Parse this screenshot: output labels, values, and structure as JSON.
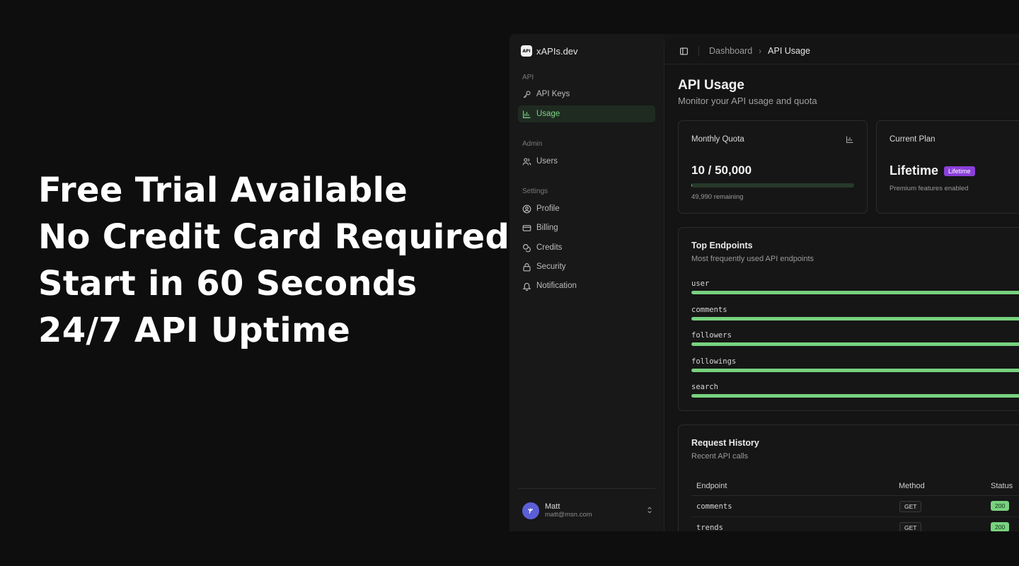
{
  "hero": {
    "lines": [
      "Free Trial Available",
      "No Credit Card Required",
      "Start in 60 Seconds",
      "24/7 API Uptime"
    ]
  },
  "app": {
    "brand": {
      "logo_text": "API",
      "name": "xAPIs.dev"
    },
    "sidebar": {
      "sections": [
        {
          "label": "API",
          "items": [
            {
              "label": "API Keys",
              "icon": "key-icon",
              "active": false
            },
            {
              "label": "Usage",
              "icon": "bar-chart-icon",
              "active": true
            }
          ]
        },
        {
          "label": "Admin",
          "items": [
            {
              "label": "Users",
              "icon": "users-icon",
              "active": false
            }
          ]
        },
        {
          "label": "Settings",
          "items": [
            {
              "label": "Profile",
              "icon": "profile-icon",
              "active": false
            },
            {
              "label": "Billing",
              "icon": "credit-card-icon",
              "active": false
            },
            {
              "label": "Credits",
              "icon": "coins-icon",
              "active": false
            },
            {
              "label": "Security",
              "icon": "lock-icon",
              "active": false
            },
            {
              "label": "Notification",
              "icon": "bell-icon",
              "active": false
            }
          ]
        }
      ],
      "user": {
        "name": "Matt",
        "email": "matt@msn.com"
      }
    },
    "breadcrumb": {
      "parent": "Dashboard",
      "current": "API Usage"
    },
    "page": {
      "title": "API Usage",
      "subtitle": "Monitor your API usage and quota"
    },
    "quota_card": {
      "title": "Monthly Quota",
      "value": "10 / 50,000",
      "remaining": "49,990 remaining",
      "used": 10,
      "total": 50000
    },
    "plan_card": {
      "title": "Current Plan",
      "plan": "Lifetime",
      "badge": "Lifetime",
      "description": "Premium features enabled"
    },
    "endpoints_card": {
      "title": "Top Endpoints",
      "description": "Most frequently used API endpoints",
      "items": [
        {
          "name": "user",
          "share": 1.0
        },
        {
          "name": "comments",
          "share": 1.0
        },
        {
          "name": "followers",
          "share": 1.0
        },
        {
          "name": "followings",
          "share": 1.0
        },
        {
          "name": "search",
          "share": 1.0
        }
      ]
    },
    "history_card": {
      "title": "Request History",
      "description": "Recent API calls",
      "columns": [
        "Endpoint",
        "Method",
        "Status"
      ],
      "rows": [
        {
          "endpoint": "comments",
          "method": "GET",
          "status": "200"
        },
        {
          "endpoint": "trends",
          "method": "GET",
          "status": "200"
        }
      ]
    },
    "colors": {
      "accent": "#78d27f",
      "badge": "#8b3fd9",
      "background": "#0e0e0e"
    }
  }
}
